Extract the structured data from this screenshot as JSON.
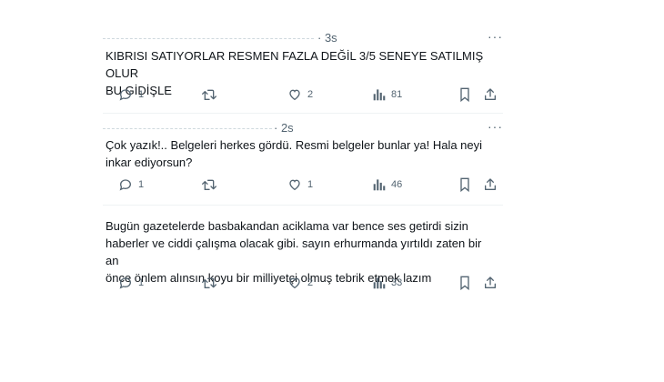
{
  "tweets": [
    {
      "time": "· 3s",
      "text_lines": [
        "KIBRISI SATIYORLAR RESMEN FAZLA DEĞİL 3/5 SENEYE SATILMIŞ OLUR",
        "BU GİDİŞLE"
      ],
      "replies": "1",
      "retweets": "",
      "likes": "2",
      "views": "81"
    },
    {
      "time": "· 2s",
      "text_lines": [
        "Çok yazık!.. Belgeleri herkes gördü. Resmi belgeler bunlar ya! Hala neyi",
        "inkar ediyorsun?"
      ],
      "replies": "1",
      "retweets": "",
      "likes": "1",
      "views": "46"
    },
    {
      "time": "",
      "text_lines": [
        "Bugün gazetelerde basbakandan aciklama var bence ses getirdi sizin",
        "haberler ve ciddi çalışma olacak gibi. sayın erhurmanda yırtıldı zaten bir an",
        "önce önlem alınsın koyu bir milliyetçi olmuş tebrik etmek lazım"
      ],
      "replies": "1",
      "retweets": "",
      "likes": "2",
      "views": "33"
    }
  ],
  "icons": {
    "reply": "reply-icon",
    "retweet": "retweet-icon",
    "like": "heart-icon",
    "views": "views-icon",
    "bookmark": "bookmark-icon",
    "share": "share-icon",
    "more": "more-icon"
  },
  "colors": {
    "text": "#0f1419",
    "muted": "#536471",
    "divider": "#eff3f4"
  }
}
